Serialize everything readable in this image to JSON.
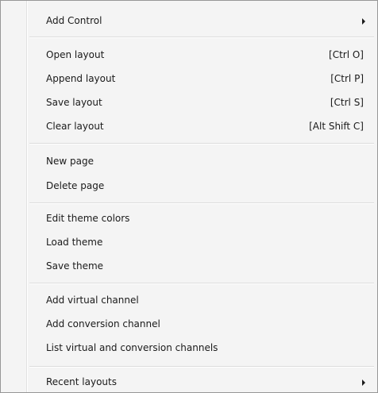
{
  "menu": {
    "add_control": {
      "label": "Add Control",
      "submenu_icon": "submenu-arrow"
    },
    "open_layout": {
      "label": "Open layout",
      "shortcut": "[Ctrl O]"
    },
    "append_layout": {
      "label": "Append layout",
      "shortcut": "[Ctrl P]"
    },
    "save_layout": {
      "label": "Save layout",
      "shortcut": "[Ctrl S]"
    },
    "clear_layout": {
      "label": "Clear layout",
      "shortcut": "[Alt Shift C]"
    },
    "new_page": {
      "label": "New page"
    },
    "delete_page": {
      "label": "Delete page"
    },
    "edit_theme_colors": {
      "label": "Edit theme colors"
    },
    "load_theme": {
      "label": "Load theme"
    },
    "save_theme": {
      "label": "Save theme"
    },
    "add_virtual_channel": {
      "label": "Add virtual channel"
    },
    "add_conversion_channel": {
      "label": "Add conversion channel"
    },
    "list_channels": {
      "label": "List virtual and conversion channels"
    },
    "recent_layouts": {
      "label": "Recent layouts",
      "submenu_icon": "submenu-arrow"
    }
  }
}
